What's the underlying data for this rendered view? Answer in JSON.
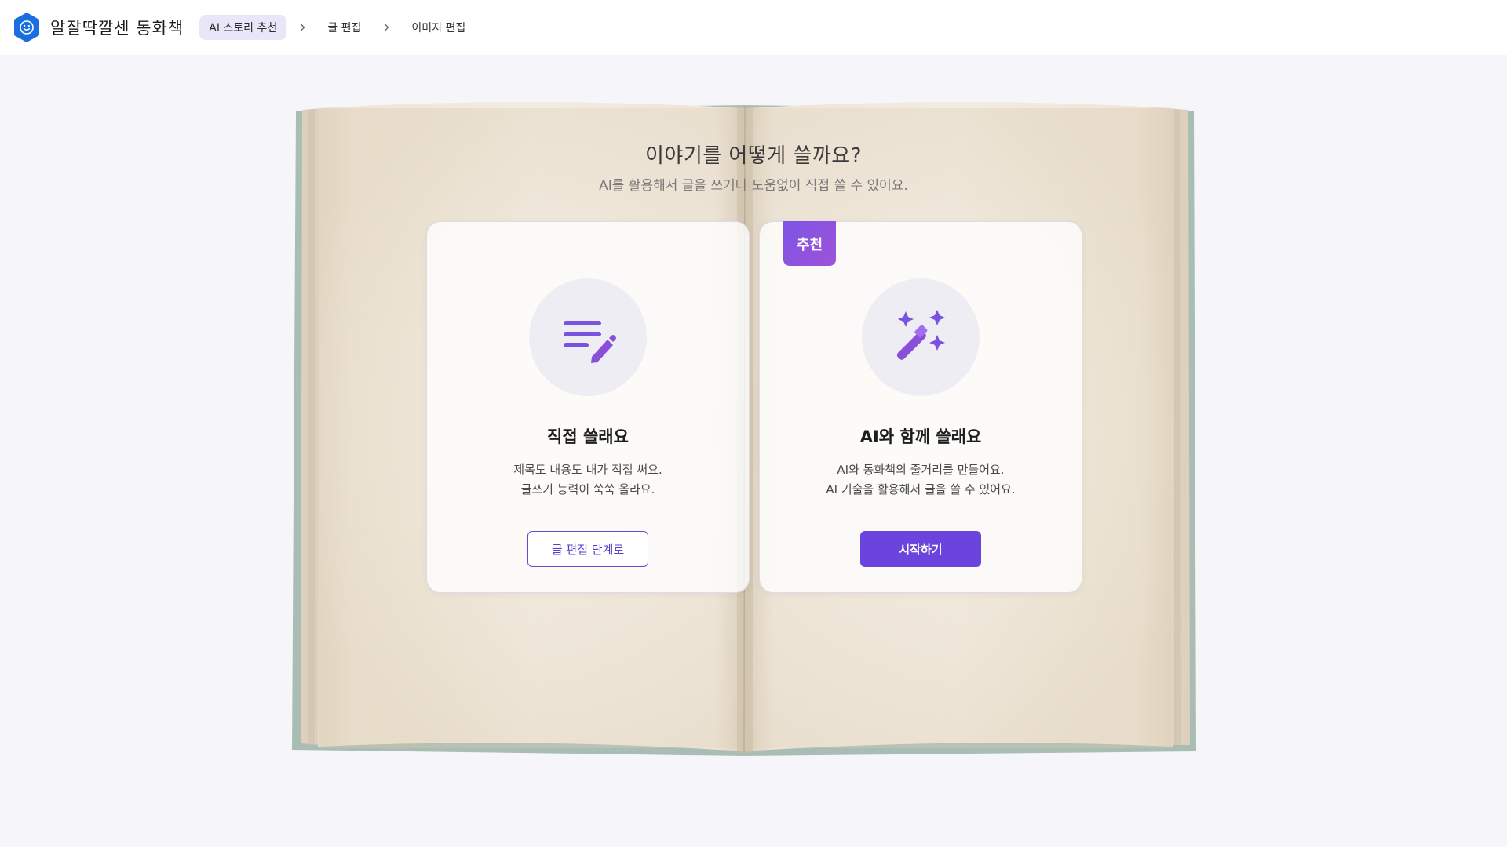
{
  "app": {
    "name": "알잘딱깔센 동화책",
    "brand_color": "#1a6fe0"
  },
  "breadcrumb": {
    "steps": [
      {
        "label": "AI 스토리 추천",
        "active": true
      },
      {
        "label": "글 편집",
        "active": false
      },
      {
        "label": "이미지 편집",
        "active": false
      }
    ]
  },
  "main": {
    "title": "이야기를 어떻게 쓸까요?",
    "subtitle": "AI를 활용해서 글을 쓰거나 도움없이 직접 쓸 수 있어요."
  },
  "cards": {
    "manual": {
      "icon": "text-pencil-icon",
      "title": "직접 쓸래요",
      "desc_line1": "제목도 내용도 내가 직접 써요.",
      "desc_line2": "글쓰기 능력이 쑥쑥 올라요.",
      "button": "글 편집 단계로"
    },
    "ai": {
      "badge": "추천",
      "icon": "magic-wand-icon",
      "title": "AI와 함께 쓸래요",
      "desc_line1": "AI와 동화책의 줄거리를 만들어요.",
      "desc_line2": "AI 기술을 활용해서 글을 쓸 수 있어요.",
      "button": "시작하기"
    }
  },
  "colors": {
    "accent": "#6a44dc",
    "background": "#f6f6fa"
  }
}
